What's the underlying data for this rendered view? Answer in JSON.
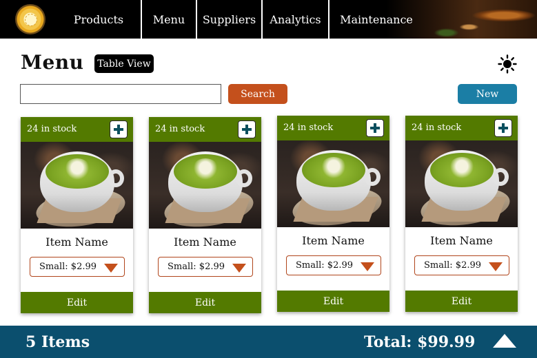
{
  "nav": {
    "items": [
      {
        "label": "Products"
      },
      {
        "label": "Menu"
      },
      {
        "label": "Suppliers"
      },
      {
        "label": "Analytics"
      },
      {
        "label": "Maintenance"
      }
    ],
    "logo_icon": "lemon-tea-icon"
  },
  "header": {
    "title": "Menu",
    "view_toggle_label": "Table View",
    "theme_icon": "sun-icon"
  },
  "search": {
    "value": "",
    "placeholder": "",
    "button_label": "Search"
  },
  "new_button_label": "New",
  "cards": [
    {
      "stock": "24 in stock",
      "name": "Item Name",
      "size": "Small: $2.99",
      "edit_label": "Edit"
    },
    {
      "stock": "24 in stock",
      "name": "Item Name",
      "size": "Small: $2.99",
      "edit_label": "Edit"
    },
    {
      "stock": "24 in stock",
      "name": "Item Name",
      "size": "Small: $2.99",
      "edit_label": "Edit"
    },
    {
      "stock": "24 in stock",
      "name": "Item Name",
      "size": "Small: $2.99",
      "edit_label": "Edit"
    }
  ],
  "footer": {
    "item_count": "5 Items",
    "total": "Total: $99.99",
    "expand_icon": "triangle-up-icon"
  },
  "colors": {
    "nav_bg": "#000000",
    "card_accent": "#537a00",
    "search_button": "#c4501c",
    "new_button": "#1b7ea5",
    "footer_bg": "#0b4f6e"
  }
}
